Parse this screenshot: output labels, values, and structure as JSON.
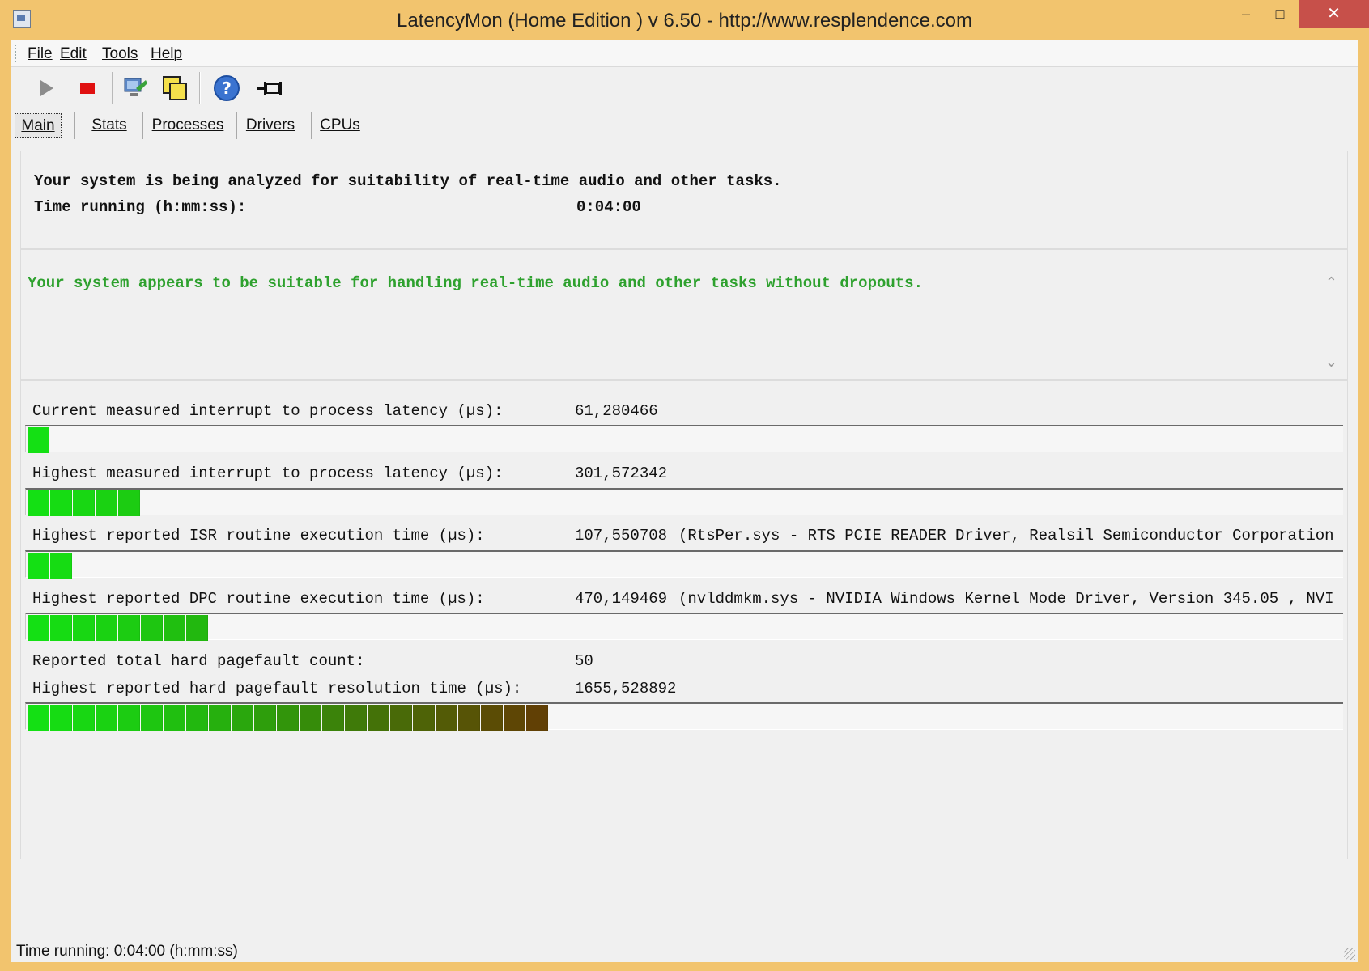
{
  "window": {
    "title": "LatencyMon  (Home Edition )  v 6.50 - http://www.resplendence.com"
  },
  "window_controls": {
    "minimize": "–",
    "maximize": "□",
    "close": "✕"
  },
  "menu": [
    "File",
    "Edit",
    "Tools",
    "Help"
  ],
  "toolbar_icons": [
    "play-icon",
    "stop-icon",
    "monitor-settings-icon",
    "windows-icon",
    "help-icon",
    "pin-icon"
  ],
  "tabs": [
    "Main",
    "Stats",
    "Processes",
    "Drivers",
    "CPUs"
  ],
  "active_tab": "Main",
  "status_panel": {
    "line1": "Your system is being analyzed for suitability of real-time audio and other tasks.",
    "time_label": "Time running (h:mm:ss):",
    "time_value": "0:04:00"
  },
  "conclusion": "Your system appears to be suitable for handling real-time audio and other tasks without dropouts.",
  "metrics": [
    {
      "label": "Current measured interrupt to process latency (µs):",
      "value": "61,280466",
      "extra": "",
      "bar_segments": 1
    },
    {
      "label": "Highest measured interrupt to process latency (µs):",
      "value": "301,572342",
      "extra": "",
      "bar_segments": 5
    },
    {
      "label": "Highest reported ISR routine execution time (µs):",
      "value": "107,550708",
      "extra": "(RtsPer.sys - RTS PCIE READER Driver, Realsil Semiconductor Corporation",
      "bar_segments": 2
    },
    {
      "label": "Highest reported DPC routine execution time (µs):",
      "value": "470,149469",
      "extra": "(nvlddmkm.sys - NVIDIA Windows Kernel Mode Driver, Version 345.05 , NVI",
      "bar_segments": 8
    },
    {
      "label": "Reported total hard pagefault count:",
      "value": "50",
      "extra": "",
      "bar_segments": 0
    },
    {
      "label": "Highest reported hard pagefault resolution time (µs):",
      "value": "1655,528892",
      "extra": "",
      "bar_segments": 23
    }
  ],
  "statusbar": "Time running: 0:04:00  (h:mm:ss)"
}
